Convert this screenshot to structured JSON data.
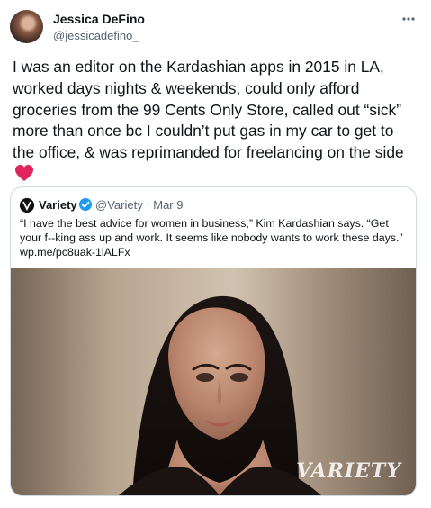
{
  "author": {
    "name": "Jessica DeFino",
    "handle": "@jessicadefino_",
    "avatar_icon": "avatar-photo"
  },
  "tweet": {
    "text": "I was an editor on the Kardashian apps in 2015 in LA, worked days nights & weekends, could only afford groceries from the 99 Cents Only Store, called out “sick” more than once bc I couldn’t put gas in my car to get to the office, & was reprimanded for freelancing on the side",
    "emoji_icon": "red-heart-icon",
    "more_icon": "more-options-icon"
  },
  "quote": {
    "name": "Variety",
    "handle_date": "@Variety · Mar 9",
    "text": "“I have the best advice for women in business,” Kim Kardashian says. “Get your f--king ass up and work. It seems like nobody wants to work these days.” wp.me/pc8uak-1lALFx",
    "logo_icon": "variety-logo-icon",
    "verified_icon": "verified-badge-icon",
    "media_watermark": "VARIETY"
  },
  "colors": {
    "text": "#0f1419",
    "secondary": "#536471",
    "border": "#cfd9de",
    "verified": "#1d9bf0",
    "heart": "#f91880"
  }
}
